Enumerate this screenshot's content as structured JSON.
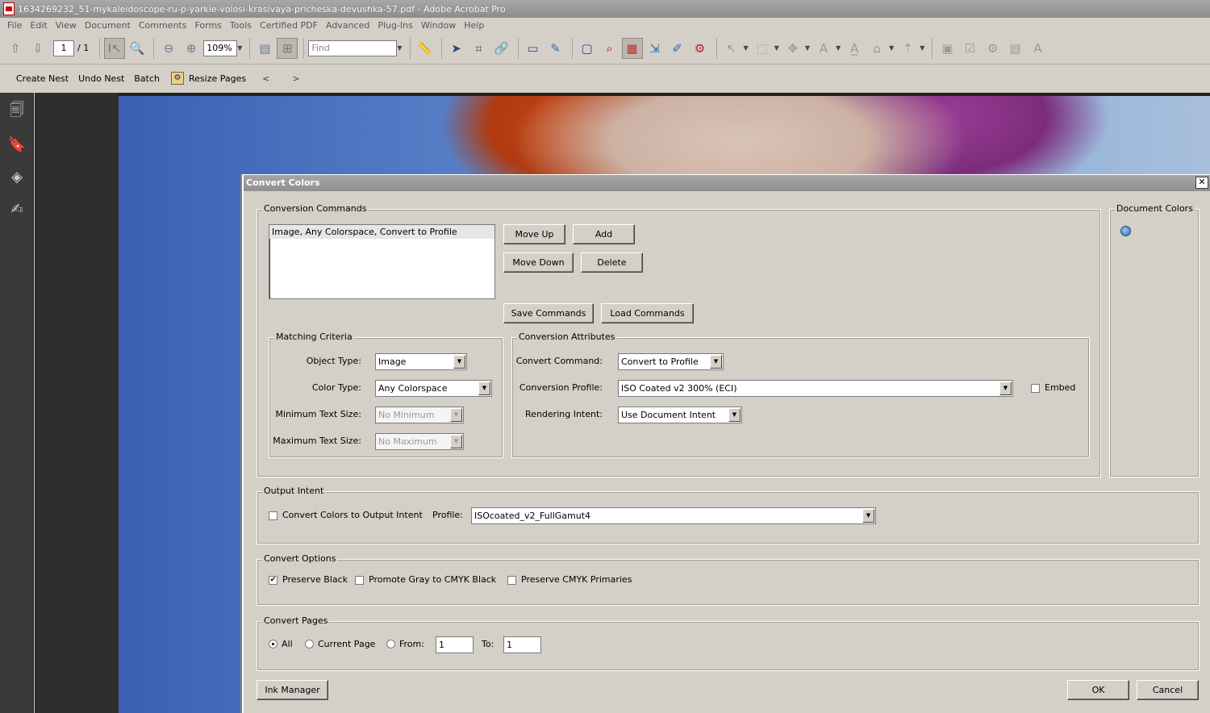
{
  "window": {
    "title": "1634269232_51-mykaleidoscope-ru-p-yarkie-volosi-krasivaya-pricheska-devushka-57.pdf - Adobe Acrobat Pro"
  },
  "menu": [
    "File",
    "Edit",
    "View",
    "Document",
    "Comments",
    "Forms",
    "Tools",
    "Certified PDF",
    "Advanced",
    "Plug-Ins",
    "Window",
    "Help"
  ],
  "toolbar": {
    "page_current": "1",
    "page_total": "/ 1",
    "zoom": "109%",
    "find_placeholder": "Find"
  },
  "toolbar2": {
    "items": [
      "Create Nest",
      "Undo Nest",
      "Batch",
      "Resize Pages"
    ],
    "prev": "<",
    "next": ">"
  },
  "dialog": {
    "title": "Convert Colors",
    "close": "✕",
    "conversion_commands": {
      "label": "Conversion Commands",
      "list": [
        "Image, Any Colorspace, Convert to Profile"
      ],
      "move_up": "Move Up",
      "add": "Add",
      "move_down": "Move Down",
      "delete": "Delete",
      "save_commands": "Save Commands",
      "load_commands": "Load Commands"
    },
    "matching_criteria": {
      "label": "Matching Criteria",
      "object_type_label": "Object Type:",
      "object_type_value": "Image",
      "color_type_label": "Color Type:",
      "color_type_value": "Any Colorspace",
      "min_text_label": "Minimum Text Size:",
      "min_text_value": "No Minimum",
      "max_text_label": "Maximum Text Size:",
      "max_text_value": "No Maximum"
    },
    "conversion_attributes": {
      "label": "Conversion Attributes",
      "convert_command_label": "Convert Command:",
      "convert_command_value": "Convert to Profile",
      "conversion_profile_label": "Conversion Profile:",
      "conversion_profile_value": "ISO Coated v2 300% (ECI)",
      "embed_label": "Embed",
      "embed_checked": false,
      "rendering_intent_label": "Rendering Intent:",
      "rendering_intent_value": "Use Document Intent"
    },
    "document_colors": {
      "label": "Document Colors"
    },
    "output_intent": {
      "label": "Output Intent",
      "convert_label": "Convert Colors to Output Intent",
      "convert_checked": false,
      "profile_label": "Profile:",
      "profile_value": "ISOcoated_v2_FullGamut4"
    },
    "convert_options": {
      "label": "Convert Options",
      "preserve_black": "Preserve Black",
      "preserve_black_checked": true,
      "promote_gray": "Promote Gray to CMYK Black",
      "promote_gray_checked": false,
      "preserve_cmyk": "Preserve CMYK Primaries",
      "preserve_cmyk_checked": false
    },
    "convert_pages": {
      "label": "Convert Pages",
      "all": "All",
      "current_page": "Current Page",
      "from_label": "From:",
      "from_value": "1",
      "to_label": "To:",
      "to_value": "1",
      "selected": "All"
    },
    "ink_manager": "Ink Manager",
    "ok": "OK",
    "cancel": "Cancel"
  },
  "colors": {
    "dialog_bg": "#d4d0c8",
    "title_bar": "#909090",
    "side_panel": "#3a3a3a"
  }
}
